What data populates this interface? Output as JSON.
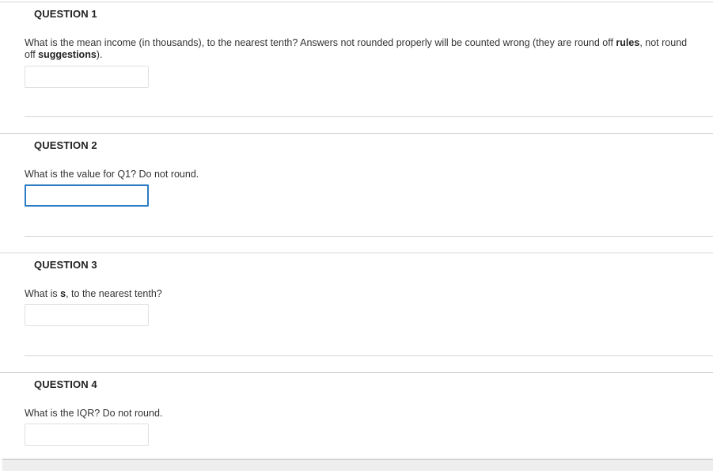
{
  "questions": [
    {
      "title": "QUESTION 1",
      "text_part1": "What is the mean income (in thousands), to the nearest tenth? Answers not rounded properly will be counted wrong (they are round off ",
      "text_bold1": "rules",
      "text_part2": ", not round off ",
      "text_bold2": "suggestions",
      "text_part3": ").",
      "answer_value": ""
    },
    {
      "title": "QUESTION 2",
      "text": "What is the value for Q1?  Do not round.",
      "answer_value": ""
    },
    {
      "title": "QUESTION 3",
      "text_part1": "What is ",
      "text_bold1": "s",
      "text_part2": ", to the nearest tenth?",
      "answer_value": ""
    },
    {
      "title": "QUESTION 4",
      "text": "What is the IQR?  Do not round.",
      "answer_value": ""
    }
  ]
}
